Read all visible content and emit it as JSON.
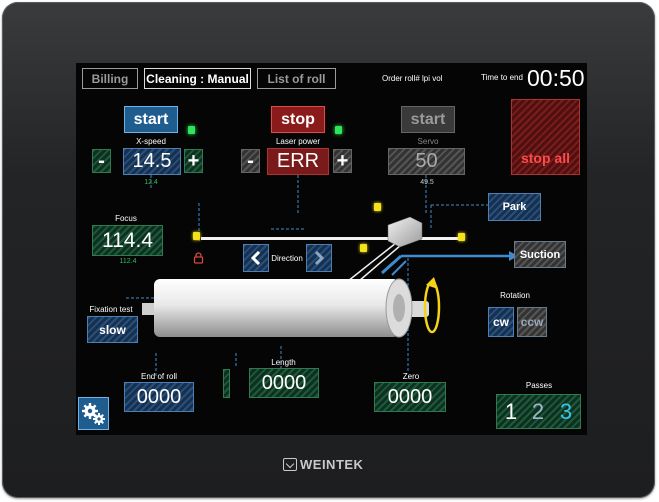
{
  "tabs": [
    {
      "label": "Billing",
      "active": false
    },
    {
      "label": "Cleaning : Manual",
      "active": true
    },
    {
      "label": "List of roll",
      "active": false
    }
  ],
  "header": {
    "order_label": "Order roll# lpi vol",
    "time_label": "Time to end",
    "time_value": "00:50"
  },
  "xspeed": {
    "start_label": "start",
    "label": "X-speed",
    "value": "14.5",
    "sub_value": "12.4",
    "minus": "-",
    "plus": "+"
  },
  "laser": {
    "stop_label": "stop",
    "label": "Laser power",
    "value": "ERR",
    "minus": "-",
    "plus": "+"
  },
  "servo": {
    "start_label": "start",
    "label": "Servo",
    "value": "50",
    "sub_value": "49.5"
  },
  "stop_all": {
    "label": "stop all"
  },
  "focus": {
    "label": "Focus",
    "value": "114.4",
    "sub_value": "112.4"
  },
  "direction": {
    "label": "Direction"
  },
  "park": {
    "label": "Park"
  },
  "suction": {
    "label": "Suction"
  },
  "fixation": {
    "label": "Fixation test",
    "button": "slow"
  },
  "rotation": {
    "label": "Rotation",
    "cw": "cw",
    "ccw": "ccw"
  },
  "end_of_roll": {
    "label": "End of roll",
    "value": "0000"
  },
  "length": {
    "label": "Length",
    "value": "0000"
  },
  "zero": {
    "label": "Zero",
    "value": "0000"
  },
  "passes": {
    "label": "Passes",
    "options": [
      "1",
      "2",
      "3"
    ]
  },
  "brand": {
    "name": "WEINTEK"
  },
  "icons": [
    "settings-gears-icon",
    "lock-icon",
    "chevron-left-icon",
    "chevron-right-icon",
    "rotation-arrow-icon"
  ],
  "colors": {
    "accent_blue": "#1f5d8f",
    "stop_red": "#8b1a1a",
    "led_green": "#2fe35b",
    "led_yellow": "#f4e31a",
    "value_green": "#2fbf5a"
  }
}
